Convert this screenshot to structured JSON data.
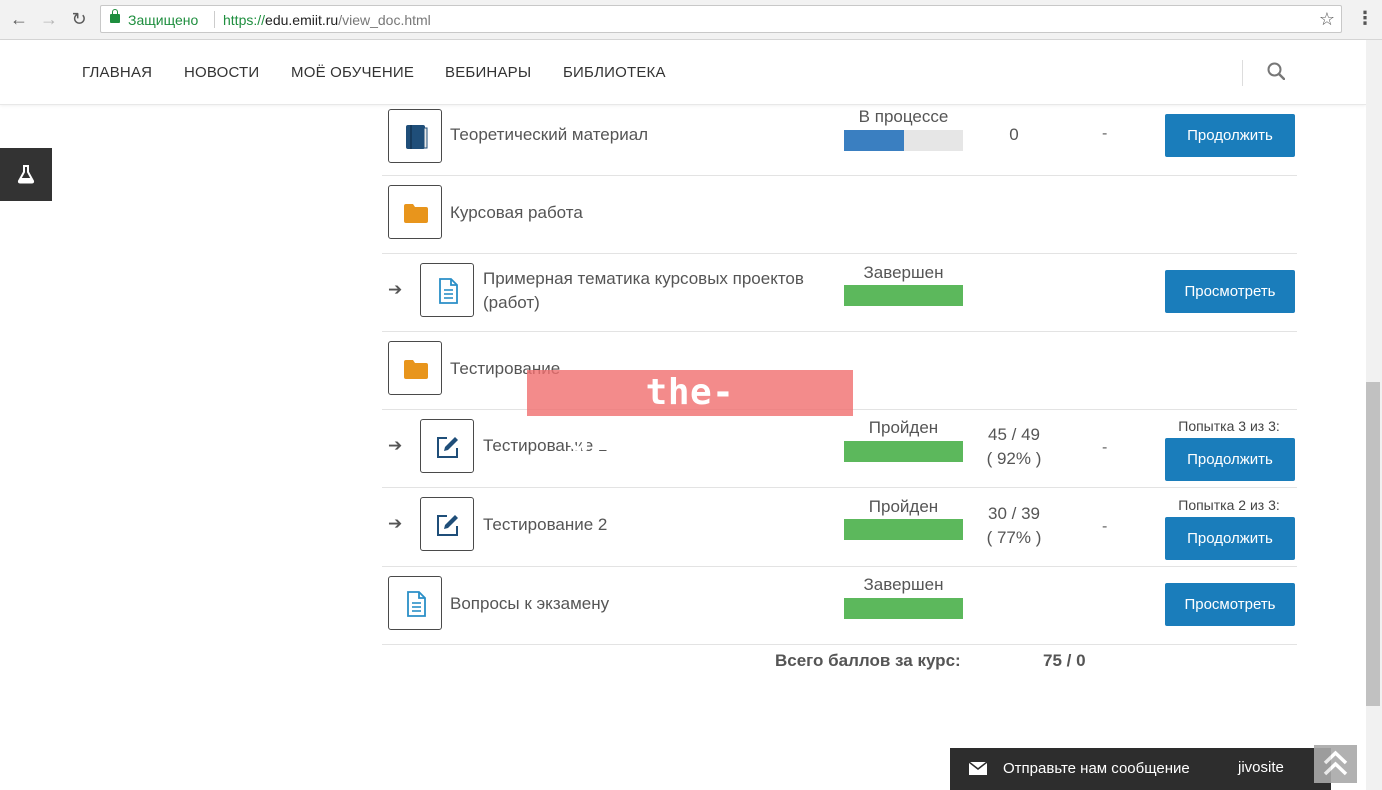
{
  "browser": {
    "secure_label": "Защищено",
    "url_scheme": "https://",
    "url_host": "edu.emiit.ru",
    "url_path": "/view_doc.html"
  },
  "nav": {
    "items": [
      "ГЛАВНАЯ",
      "НОВОСТИ",
      "МОЁ ОБУЧЕНИЕ",
      "ВЕБИНАРЫ",
      "БИБЛИОТЕКА"
    ]
  },
  "rows": [
    {
      "type": "book",
      "title": "Теоретический материал",
      "status": "В процессе",
      "progress": 0.5,
      "progress_color": "#3a7fc1",
      "score": "0",
      "dash": "-",
      "button": "Продолжить"
    },
    {
      "type": "folder",
      "title": "Курсовая работа"
    },
    {
      "type": "doc",
      "sub": true,
      "title": "Примерная тематика курсовых проектов (работ)",
      "status": "Завершен",
      "progress": 1.0,
      "progress_color": "#5cb85c",
      "button": "Просмотреть"
    },
    {
      "type": "folder",
      "title": "Тестирование"
    },
    {
      "type": "edit",
      "sub": true,
      "title": "Тестирование 1",
      "status": "Пройден",
      "progress": 1.0,
      "progress_color": "#5cb85c",
      "score_line1": "45 / 49",
      "score_line2": "( 92% )",
      "dash": "-",
      "attempt": "Попытка 3 из 3:",
      "button": "Продолжить"
    },
    {
      "type": "edit",
      "sub": true,
      "title": "Тестирование 2",
      "status": "Пройден",
      "progress": 1.0,
      "progress_color": "#5cb85c",
      "score_line1": "30 / 39",
      "score_line2": "( 77% )",
      "dash": "-",
      "attempt": "Попытка 2 из 3:",
      "button": "Продолжить"
    },
    {
      "type": "doc",
      "title": "Вопросы к экзамену",
      "status": "Завершен",
      "progress": 1.0,
      "progress_color": "#5cb85c",
      "button": "Просмотреть"
    }
  ],
  "total": {
    "label": "Всего баллов за курс:",
    "value": "75 / 0"
  },
  "watermark": "the-distance.ru",
  "chat": {
    "text": "Отправьте нам сообщение",
    "brand": "jivosite"
  },
  "colors": {
    "button": "#1a7dbb",
    "folder": "#e8951c",
    "book": "#1f4e79",
    "doc_icon": "#2a8fc7"
  }
}
